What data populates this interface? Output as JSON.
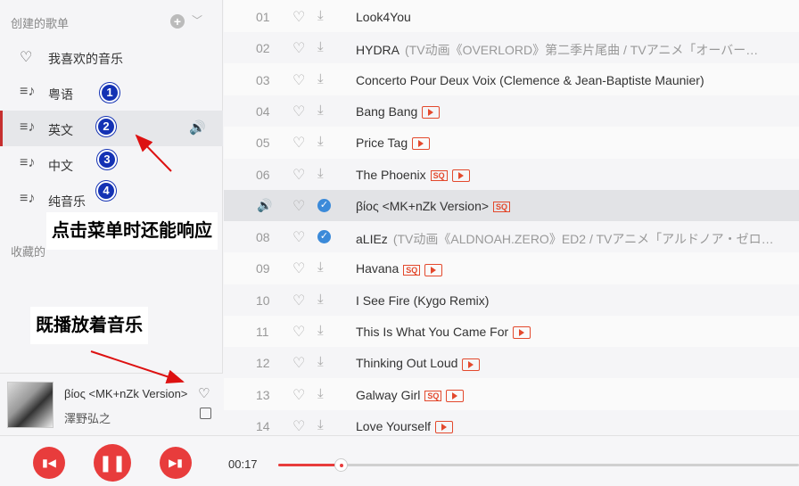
{
  "sidebar": {
    "created_title": "创建的歌单",
    "plus_icon": "plus-circle-icon",
    "items": [
      {
        "icon": "heart-icon",
        "label": "我喜欢的音乐"
      },
      {
        "icon": "playlist-icon",
        "label": "粤语",
        "badge": "1"
      },
      {
        "icon": "playlist-icon",
        "label": "英文",
        "badge": "2",
        "active": true
      },
      {
        "icon": "playlist-icon",
        "label": "中文",
        "badge": "3"
      },
      {
        "icon": "playlist-icon",
        "label": "纯音乐",
        "badge": "4"
      }
    ],
    "collected_title": "收藏的"
  },
  "annotations": {
    "menu_note": "点击菜单时还能响应",
    "music_note": "既播放着音乐"
  },
  "now_playing": {
    "song": "βίος <MK+nZk Version>",
    "artist": "澤野弘之"
  },
  "songs": [
    {
      "num": "01",
      "title": "Look4You",
      "sub": "",
      "downloaded": false,
      "sq": false,
      "mv": false
    },
    {
      "num": "02",
      "title": "HYDRA",
      "sub": "(TV动画《OVERLORD》第二季片尾曲 / TVアニメ「オーバー…",
      "downloaded": false,
      "sq": false,
      "mv": false
    },
    {
      "num": "03",
      "title": "Concerto Pour Deux Voix (Clemence & Jean-Baptiste Maunier)",
      "sub": "",
      "downloaded": false,
      "sq": false,
      "mv": false
    },
    {
      "num": "04",
      "title": "Bang Bang",
      "sub": "",
      "downloaded": false,
      "sq": false,
      "mv": true
    },
    {
      "num": "05",
      "title": "Price Tag",
      "sub": "",
      "downloaded": false,
      "sq": false,
      "mv": true
    },
    {
      "num": "06",
      "title": "The Phoenix",
      "sub": "",
      "downloaded": false,
      "sq": true,
      "mv": true
    },
    {
      "num": "",
      "title": "βίος <MK+nZk Version>",
      "sub": "",
      "downloaded": true,
      "sq": true,
      "mv": false,
      "playing": true
    },
    {
      "num": "08",
      "title": "aLIEz",
      "sub": "(TV动画《ALDNOAH.ZERO》ED2 / TVアニメ「アルドノア・ゼロ…",
      "downloaded": true,
      "sq": false,
      "mv": false
    },
    {
      "num": "09",
      "title": "Havana",
      "sub": "",
      "downloaded": false,
      "sq": true,
      "mv": true
    },
    {
      "num": "10",
      "title": "I See Fire (Kygo Remix)",
      "sub": "",
      "downloaded": false,
      "sq": false,
      "mv": false
    },
    {
      "num": "11",
      "title": "This Is What You Came For",
      "sub": "",
      "downloaded": false,
      "sq": false,
      "mv": true
    },
    {
      "num": "12",
      "title": "Thinking Out Loud",
      "sub": "",
      "downloaded": false,
      "sq": false,
      "mv": true
    },
    {
      "num": "13",
      "title": "Galway Girl",
      "sub": "",
      "downloaded": false,
      "sq": true,
      "mv": true
    },
    {
      "num": "14",
      "title": "Love Yourself",
      "sub": "",
      "downloaded": false,
      "sq": false,
      "mv": true
    }
  ],
  "sq_label": "SQ",
  "player": {
    "time": "00:17",
    "progress": 0.12
  },
  "colors": {
    "accent": "#c62f2f",
    "button": "#e83c3c",
    "badge": "#1432b4"
  }
}
